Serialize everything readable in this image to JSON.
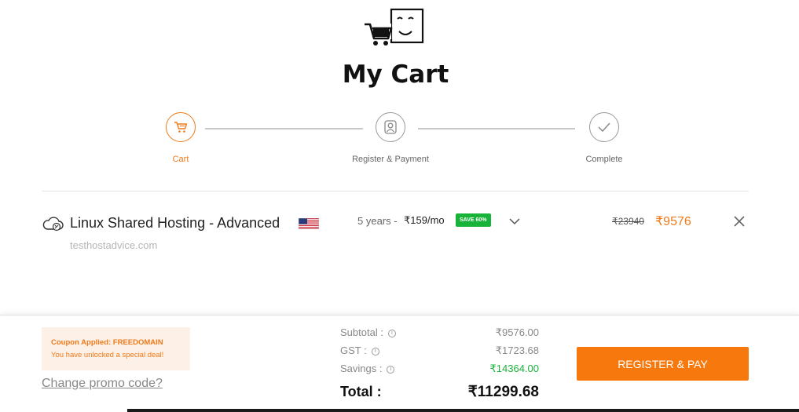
{
  "header": {
    "title": "My Cart",
    "logo_icon": "cart-smile-icon"
  },
  "stepper": {
    "accent": "#f07a1a",
    "steps": [
      {
        "label": "Cart",
        "icon": "cart-icon",
        "active": true
      },
      {
        "label": "Register & Payment",
        "icon": "user-icon",
        "active": false
      },
      {
        "label": "Complete",
        "icon": "check-icon",
        "active": false
      }
    ]
  },
  "cart_item": {
    "product_name": "Linux Shared Hosting - Advanced",
    "product_icon": "cloud-icon",
    "flag": "us-flag-icon",
    "domain": "testhostadvice.com",
    "term": "5 years -",
    "price_per_month": "₹159/mo",
    "save_badge": "SAVE 60%",
    "old_price": "₹23940",
    "new_price": "₹9576"
  },
  "coupon": {
    "line1": "Coupon Applied: FREEDOMAIN",
    "line2": "You have unlocked a special deal!",
    "change_link": "Change promo code?"
  },
  "summary": {
    "subtotal_label": "Subtotal :",
    "subtotal_value": "₹9576.00",
    "gst_label": "GST :",
    "gst_value": "₹1723.68",
    "savings_label": "Savings :",
    "savings_value": "₹14364.00",
    "total_label": "Total :",
    "total_value": "₹11299.68"
  },
  "actions": {
    "pay_label": "REGISTER & PAY"
  },
  "colors": {
    "accent": "#f7790e",
    "green": "#19b33a"
  }
}
